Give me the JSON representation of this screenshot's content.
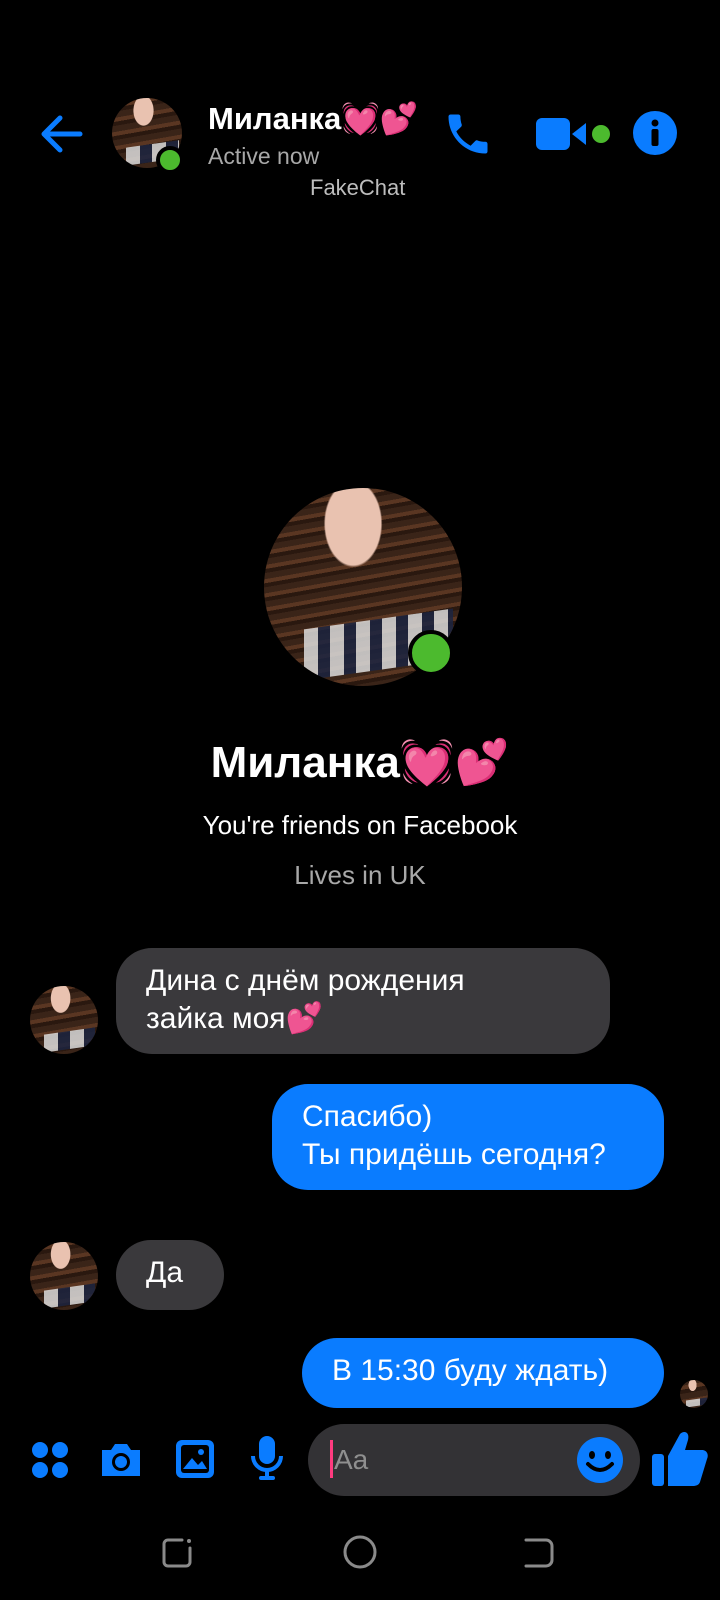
{
  "header": {
    "contact_name": "Миланка💓💕",
    "status": "Active now",
    "watermark": "FakeChat"
  },
  "profile": {
    "name": "Миланка💓💕",
    "relationship": "You're friends on Facebook",
    "location": "Lives in UK"
  },
  "messages": [
    {
      "direction": "received",
      "lines": [
        "Дина с днём рождения",
        "зайка моя💕"
      ]
    },
    {
      "direction": "sent",
      "lines": [
        "Спасибо)",
        "Ты придёшь сегодня?"
      ]
    },
    {
      "direction": "received",
      "lines": [
        "Да"
      ]
    },
    {
      "direction": "sent",
      "lines": [
        "В 15:30 буду ждать)"
      ]
    }
  ],
  "composer": {
    "placeholder": "Aa"
  },
  "icons": {
    "back": "back-arrow-icon",
    "call": "phone-icon",
    "video": "video-camera-icon",
    "info": "info-icon",
    "apps": "apps-grid-icon",
    "camera": "camera-icon",
    "gallery": "image-icon",
    "mic": "microphone-icon",
    "emoji": "emoji-icon",
    "like": "thumbs-up-icon"
  },
  "colors": {
    "accent": "#0a7cff",
    "online": "#4cba2e",
    "received_bubble": "#3a393c",
    "background": "#000000"
  }
}
